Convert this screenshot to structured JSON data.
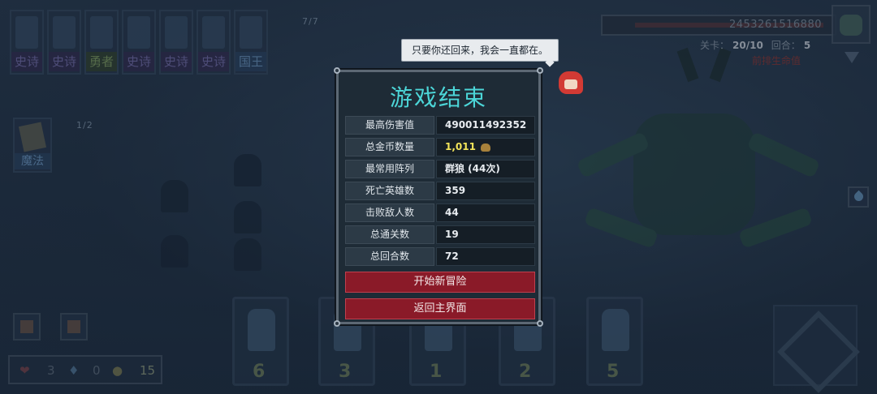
{
  "top_cards": [
    {
      "label": "史诗",
      "type": "epic"
    },
    {
      "label": "史诗",
      "type": "epic"
    },
    {
      "label": "勇者",
      "type": "brave"
    },
    {
      "label": "史诗",
      "type": "epic"
    },
    {
      "label": "史诗",
      "type": "epic"
    },
    {
      "label": "史诗",
      "type": "epic"
    },
    {
      "label": "国王",
      "type": "king"
    }
  ],
  "deck_count": "7/7",
  "magic_count": "1/2",
  "magic_label": "魔法",
  "boss": {
    "hp_value": "2453261516880",
    "level_label": "关卡：",
    "level_value": "20/10",
    "round_label": "回合：",
    "round_value": "5",
    "warning": "前排生命值"
  },
  "resources": {
    "hearts": "3",
    "mana": "0",
    "gold": "15"
  },
  "hero_costs": [
    "6",
    "3",
    "1",
    "2",
    "5"
  ],
  "speech": "只要你还回来，我会一直都在。",
  "modal": {
    "title": "游戏结束",
    "stats": [
      {
        "label": "最高伤害值",
        "value": "490011492352",
        "icon": "damage-icon"
      },
      {
        "label": "总金币数量",
        "value": "1,011",
        "icon": "gold-icon",
        "gold": true
      },
      {
        "label": "最常用阵列",
        "value": "群狼 (44次)"
      },
      {
        "label": "死亡英雄数",
        "value": "359"
      },
      {
        "label": "击败敌人数",
        "value": "44"
      },
      {
        "label": "总通关数",
        "value": "19"
      },
      {
        "label": "总回合数",
        "value": "72"
      }
    ],
    "new_adventure": "开始新冒险",
    "main_menu": "返回主界面"
  },
  "colors": {
    "title": "#4cd6d8",
    "button": "#8a1a28",
    "gold_text": "#f2e45a"
  }
}
